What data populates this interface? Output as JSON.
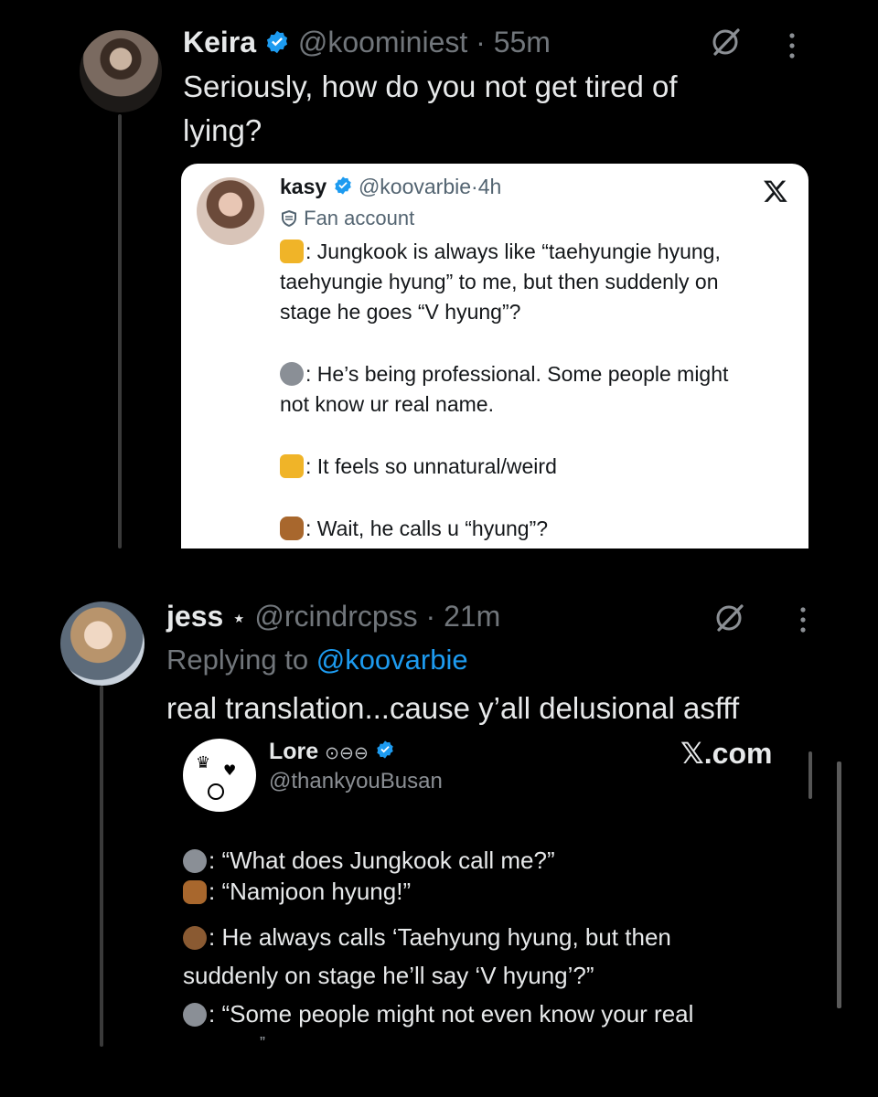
{
  "post1": {
    "name": "Keira",
    "handle": "@koominiest",
    "sep": "·",
    "time": "55m",
    "text_line1": "Seriously, how do you not get tired of",
    "text_line2": "lying?"
  },
  "quote1": {
    "name": "kasy",
    "handle": "@koovarbie",
    "sep": "·",
    "time": "4h",
    "badge": "Fan account",
    "lines": [
      ": Jungkook is always like “taehyungie hyung,",
      "taehyungie hyung” to me, but then suddenly on",
      "stage he goes “V hyung”?",
      ": He’s being professional. Some people might",
      "not know ur real name.",
      ": It feels so unnatural/weird",
      ": Wait, he calls u “hyung”?"
    ]
  },
  "post2": {
    "name": "jess",
    "star": "⋆",
    "handle": "@rcindrcpss",
    "sep": "·",
    "time": "21m",
    "replying_prefix": "Replying to ",
    "replying_to": "@koovarbie",
    "text": "real translation...cause y’all delusional asfff"
  },
  "quote2": {
    "name": "Lore",
    "name_symbols": "⊙⊖⊖",
    "handle": "@thankyouBusan",
    "brand": "𝕏.com",
    "lines": [
      ": “What does Jungkook call me?”",
      ": “Namjoon hyung!”",
      ": He always calls ‘Taehyung hyung, but then",
      "suddenly on stage he’ll say ‘V hyung’?”",
      ": “Some people might not even know your real",
      "”"
    ]
  },
  "colors": {
    "background": "#000000",
    "link": "#1d9bf0",
    "verified": "#1d9bf0",
    "muted": "#71767b"
  },
  "icons": [
    "verified-icon",
    "grok-icon",
    "more-icon",
    "x-logo-icon",
    "shield-icon",
    "tiger-emoji",
    "koala-emoji",
    "squirrel-emoji",
    "bear-emoji"
  ]
}
